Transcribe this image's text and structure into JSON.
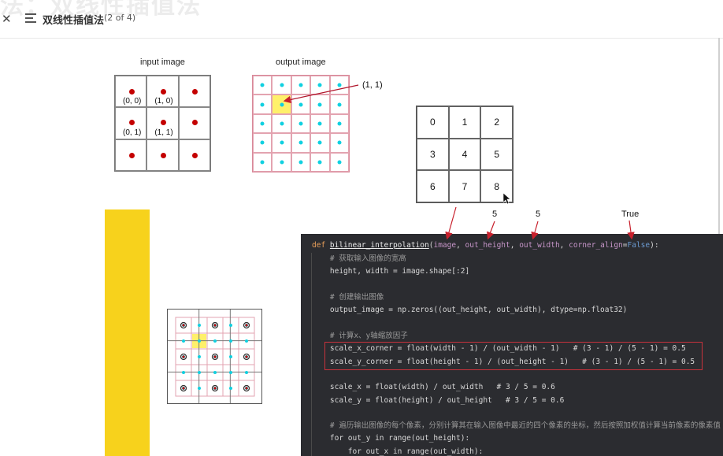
{
  "header": {
    "ghost_title": "法：双线性插值法",
    "title": "双线性插值法",
    "position": "(2 of 4)"
  },
  "figure": {
    "input_caption": "input image",
    "output_caption": "output image",
    "input_coords": [
      "(0, 0)",
      "(1,  0)",
      "(0, 1)",
      "(1, 1)"
    ],
    "callout": "(1, 1)"
  },
  "number_grid": {
    "cells": [
      "0",
      "1",
      "2",
      "3",
      "4",
      "5",
      "6",
      "7",
      "8"
    ]
  },
  "annotations": {
    "out_height": "5",
    "out_width": "5",
    "corner_align": "True"
  },
  "code": {
    "line1_def": "def ",
    "line1_fn": "bilinear_interpolation",
    "line1_open": "(",
    "line1_p1": "image",
    "line1_c1": ", ",
    "line1_p2": "out_height",
    "line1_c2": ", ",
    "line1_p3": "out_width",
    "line1_c3": ", ",
    "line1_p4": "corner_align",
    "line1_eq": "=",
    "line1_false": "False",
    "line1_close": "):",
    "c1": "    # 获取输入图像的宽高",
    "l2": "    height, width = image.shape[:2]",
    "c2": "    # 创建输出图像",
    "l3": "    output_image = np.zeros((out_height, out_width), dtype=np.float32)",
    "c3": "    # 计算x、y轴缩放因子",
    "l4": "    scale_x_corner = float(width - 1) / (out_width - 1)   # (3 - 1) / (5 - 1) = 0.5",
    "l5": "    scale_y_corner = float(height - 1) / (out_height - 1)   # (3 - 1) / (5 - 1) = 0.5",
    "l6": "    scale_x = float(width) / out_width   # 3 / 5 = 0.6",
    "l7": "    scale_y = float(height) / out_height   # 3 / 5 = 0.6",
    "c4": "    # 遍历输出图像的每个像素，分别计算其在输入图像中最近的四个像素的坐标，然后按照加权值计算当前像素的像素值",
    "l8": "    for out_y in range(out_height):",
    "l9": "        for out_x in range(out_width):"
  }
}
